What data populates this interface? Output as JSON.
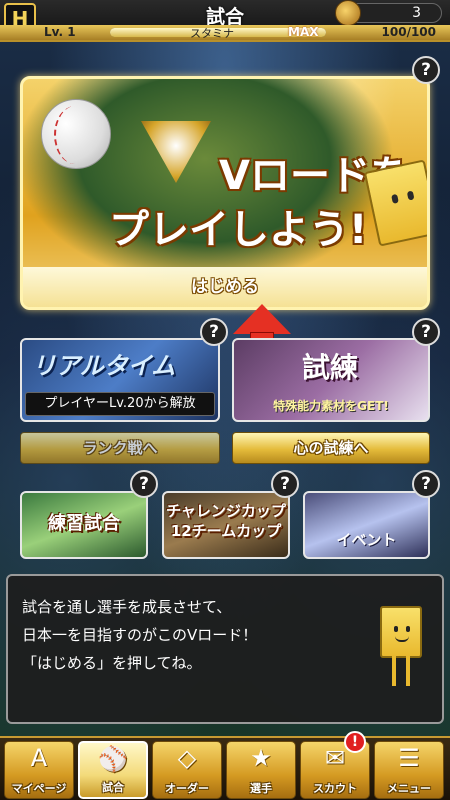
{
  "header": {
    "logo_text": "H",
    "title": "試合",
    "coin_count": "3",
    "level": "Lv. 1",
    "stamina_label": "スタミナ",
    "stamina_max_label": "MAX",
    "stamina_value": "100/100",
    "stamina_fraction": 1.0
  },
  "help_label": "?",
  "vroad": {
    "title_line1": "Vロードを",
    "title_line2": "プレイしよう!",
    "start_label": "はじめる"
  },
  "modes": {
    "realtime": {
      "art_text": "リアルタイム",
      "lock_text": "プレイヤーLv.20から解放",
      "button_label": "ランク戦へ"
    },
    "trial": {
      "art_text": "試練",
      "sub_text": "特殊能力素材をGET!",
      "button_label": "心の試練へ"
    },
    "practice": {
      "art_text": "練習試合"
    },
    "challenge": {
      "art_line1": "チャレンジカップ",
      "art_line2": "12チームカップ"
    },
    "event": {
      "art_text": "イベント"
    }
  },
  "dialog": {
    "lines": [
      "試合を通し選手を成長させて、",
      "日本一を目指すのがこのVロード！",
      "「はじめる」を押してね。"
    ]
  },
  "nav": {
    "tabs": [
      {
        "label": "マイページ",
        "glyph": "A"
      },
      {
        "label": "試合",
        "glyph": "⚾"
      },
      {
        "label": "オーダー",
        "glyph": "◇"
      },
      {
        "label": "選手",
        "glyph": "★"
      },
      {
        "label": "スカウト",
        "glyph": "✉"
      },
      {
        "label": "メニュー",
        "glyph": "☰"
      }
    ],
    "scout_badge": "!"
  },
  "colors": {
    "gold": "#e4bb3a",
    "arrow_red": "#e53023",
    "badge_red": "#e02020"
  }
}
